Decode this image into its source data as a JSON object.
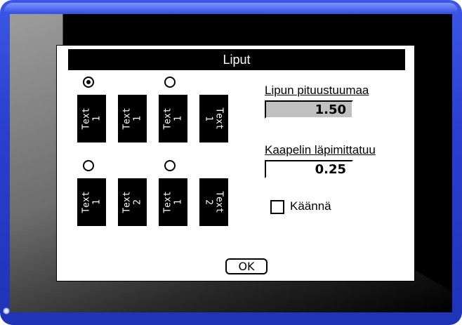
{
  "dialog": {
    "title": "Liput",
    "options": [
      {
        "selected": true,
        "flags": [
          "Text\n1",
          "Text\n1"
        ],
        "reversed_second": false
      },
      {
        "selected": false,
        "flags": [
          "Text\n1",
          "Text\n1"
        ],
        "reversed_second": true
      },
      {
        "selected": false,
        "flags": [
          "Text\n1",
          "Text\n2"
        ],
        "reversed_second": false
      },
      {
        "selected": false,
        "flags": [
          "Text\n1",
          "Text\n2"
        ],
        "reversed_second": true
      }
    ],
    "flag_length_label": "Lipun pituustuumaa",
    "flag_length_value": "1.50",
    "cable_diameter_label": "Kaapelin läpimittatuu",
    "cable_diameter_value": "0.25",
    "reverse_label": "Käännä",
    "reverse_checked": false,
    "ok_label": "OK"
  },
  "colors": {
    "bezel": "#2a3fd0",
    "selected_field": "#c0c0c0"
  }
}
